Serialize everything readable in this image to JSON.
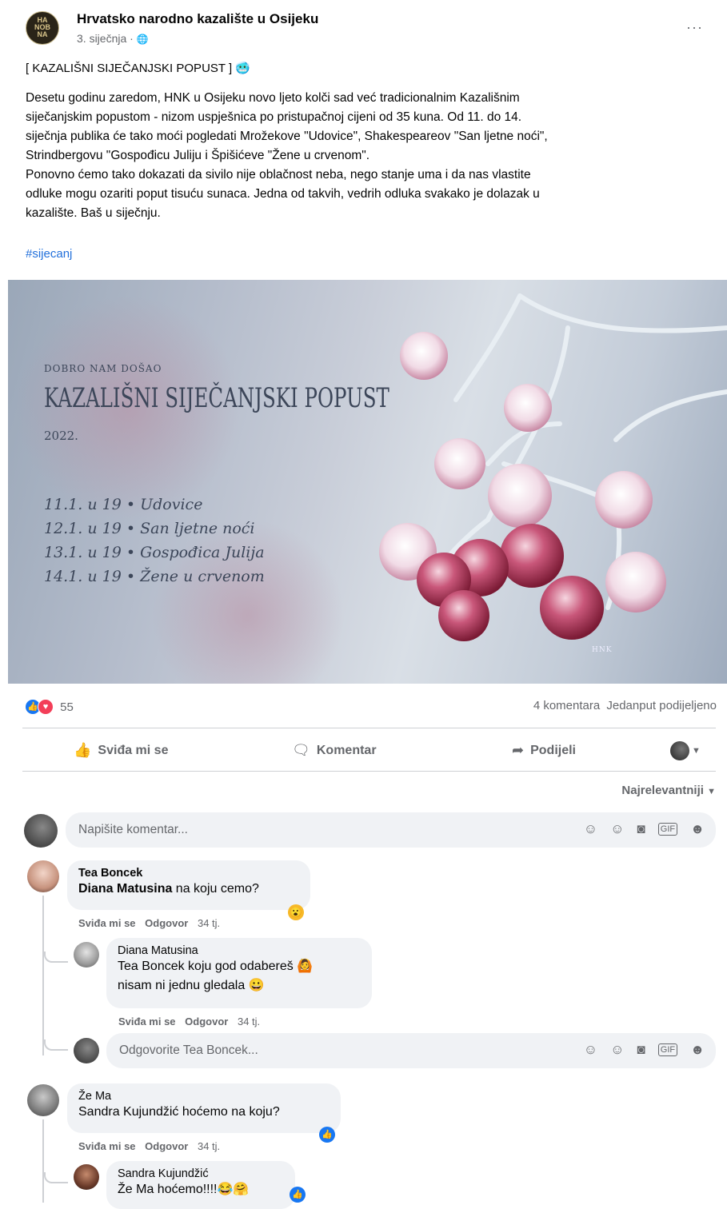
{
  "post": {
    "page_avatar_letters": "HA\nNOBIN\nNA",
    "page_name": "Hrvatsko narodno kazalište u Osijeku",
    "date": "3. siječnja · ",
    "title": "[ KAZALIŠNI SIJEČANJSKI POPUST ] 🥶",
    "body_lines": [
      "Desetu godinu zaredom, HNK u Osijeku novo ljeto kolči sad već tradicionalnim Kazališnim",
      "siječanjskim popustom - nizom uspješnica po pristupačnoj cijeni od 35 kuna. Od 11. do 14.",
      "siječnja publika će tako moći pogledati Mrožekove \"Udovice\", Shakespeareov \"San ljetne noći\",",
      "Strindbergovu \"Gospođicu Juliju i Špišićeve \"Žene u crvenom\".",
      "Ponovno ćemo tako dokazati da sivilo nije oblačnost neba, nego stanje uma i da nas vlastite",
      "odluke mogu ozariti poput tisuću sunaca. Jedna od takvih, vedrih odluka svakako je dolazak u",
      "kazalište. Baš u siječnju."
    ],
    "hashtag": "#sijecanj"
  },
  "photo": {
    "kicker": "DOBRO NAM DOŠAO",
    "headline": "KAZALIŠNI SIJEČANJSKI POPUST",
    "year": "2022.",
    "schedule": [
      "11.1. u 19 • Udovice",
      "12.1. u 19 • San ljetne noći",
      "13.1. u 19 • Gospođica Julija",
      "14.1. u 19 • Žene u crvenom"
    ],
    "credit": "HNK"
  },
  "stats": {
    "reaction_count": "55",
    "comments": "4 komentara",
    "shares": "Jedanput podijeljeno"
  },
  "actions": {
    "like": "Sviđa mi se",
    "comment": "Komentar",
    "share": "Podijeli"
  },
  "sort_label": "Najrelevantniji",
  "comment_box": {
    "placeholder": "Napišite komentar..."
  },
  "comments": [
    {
      "name": "Tea Boncek",
      "mention": "Diana Matusina",
      "text": " na koju cemo?",
      "like": "Sviđa mi se",
      "reply": "Odgovor",
      "time": "34 tj.",
      "reaction": "😮"
    },
    {
      "name": "Diana Matusina",
      "mention": "Tea Boncek",
      "text": " koju god odabereš 🙆",
      "text2": "nisam ni jednu gledala 😀",
      "like": "Sviđa mi se",
      "reply": "Odgovor",
      "time": "34 tj."
    },
    {
      "name": "Že Ma",
      "mention": "Sandra Kujundžić",
      "text": " hoćemo na koju?",
      "like": "Sviđa mi se",
      "reply": "Odgovor",
      "time": "34 tj.",
      "reaction": "👍"
    },
    {
      "name": "Sandra Kujundžić",
      "mention": "Že Ma",
      "text": " hoćemo!!!!😂🤗"
    }
  ],
  "reply_box": {
    "placeholder": "Odgovorite Tea Boncek..."
  },
  "colors": {
    "link": "#216fdb",
    "like_blue": "#1877f2",
    "love_red": "#f33e58",
    "muted": "#65676b",
    "bubble": "#f0f2f5"
  }
}
